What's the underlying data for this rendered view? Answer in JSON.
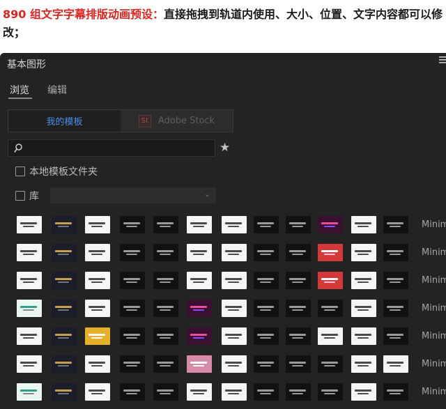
{
  "caption": {
    "highlight": "890 组文字字幕排版动画预设：",
    "rest": "直接拖拽到轨道内使用、大小、位置、文字内容都可以修改；"
  },
  "panel": {
    "title": "基本图形",
    "menu_icon": "hamburger-icon"
  },
  "tabs": [
    {
      "label": "浏览"
    },
    {
      "label": "编辑"
    }
  ],
  "segments": {
    "mine": "我的模板",
    "stock_logo": "St",
    "stock": "Adobe Stock"
  },
  "search": {
    "placeholder": "",
    "icon": "search-icon"
  },
  "favorites_icon": "star-icon",
  "local_templates": {
    "label": "本地模板文件夹",
    "checked": false
  },
  "library": {
    "label": "库",
    "checked": false,
    "selected": ""
  },
  "row_labels": [
    "Minim",
    "Minim",
    "Minim",
    "Minim",
    "Minim",
    "Minim",
    "Minim"
  ],
  "thumbnail_styles": [
    [
      "light",
      "navy",
      "light",
      "dark",
      "dark",
      "light",
      "light",
      "dark",
      "dark",
      "magenta",
      "light",
      "dark"
    ],
    [
      "light",
      "navy",
      "light",
      "dark",
      "dark",
      "light",
      "light",
      "dark",
      "dark",
      "red",
      "light",
      "dark"
    ],
    [
      "light",
      "navy",
      "light",
      "dark",
      "dark",
      "light",
      "light",
      "dark",
      "dark",
      "red",
      "light",
      "dark"
    ],
    [
      "teal",
      "navy",
      "light",
      "dark",
      "dark",
      "magenta",
      "light",
      "dark",
      "dark",
      "dark",
      "light",
      "dark"
    ],
    [
      "light",
      "navy",
      "gold",
      "dark",
      "dark",
      "magenta",
      "light",
      "dark",
      "dark",
      "light",
      "light",
      "dark"
    ],
    [
      "light",
      "navy",
      "light",
      "dark",
      "dark",
      "pink",
      "light",
      "dark",
      "dark",
      "dark",
      "light",
      "light"
    ],
    [
      "teal",
      "navy",
      "light",
      "dark",
      "dark",
      "light",
      "light",
      "dark",
      "dark",
      "dark",
      "light",
      "dark"
    ]
  ],
  "colors": {
    "panel_bg": "#232323",
    "accent": "#4a8fe6",
    "caption_highlight": "#e0231f"
  }
}
